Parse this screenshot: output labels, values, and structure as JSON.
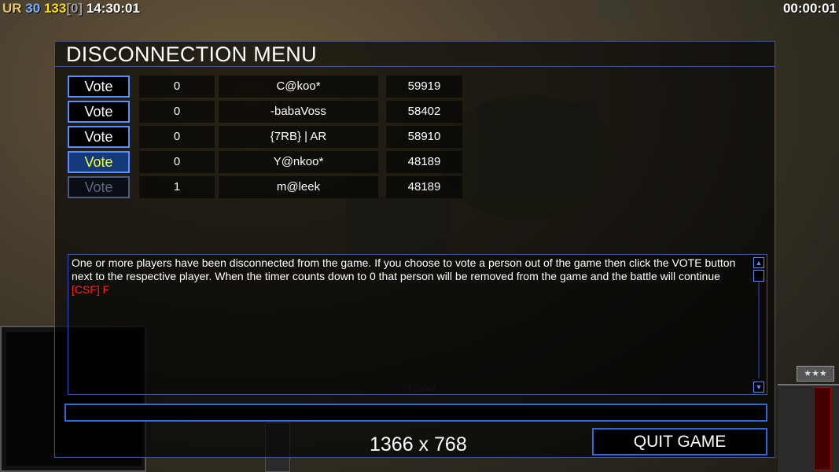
{
  "hud": {
    "prefix": "UR",
    "fps": "30",
    "latency": "133",
    "frame": "[0]",
    "clock": "14:30:01",
    "timer": "00:00:01"
  },
  "menu": {
    "title": "DISCONNECTION MENU",
    "players": [
      {
        "vote_label": "Vote",
        "votes": "0",
        "name": "C@koo*",
        "ping": "59919",
        "state": "normal"
      },
      {
        "vote_label": "Vote",
        "votes": "0",
        "name": "-babaVoss",
        "ping": "58402",
        "state": "normal"
      },
      {
        "vote_label": "Vote",
        "votes": "0",
        "name": "{7RB} | AR",
        "ping": "58910",
        "state": "normal"
      },
      {
        "vote_label": "Vote",
        "votes": "0",
        "name": "Y@nkoo*",
        "ping": "48189",
        "state": "hover"
      },
      {
        "vote_label": "Vote",
        "votes": "1",
        "name": "m@leek",
        "ping": "48189",
        "state": "disabled"
      }
    ],
    "message": "One or more players have been disconnected from the game. If you choose to vote a person out of the game then click the VOTE button next to the respective player. When the timer counts down to 0 that person will be removed from the game and the battle will continue",
    "chat_line": "[CSF] F",
    "chat_input_value": "",
    "resolution": "1366 x 768",
    "quit_label": "QUIT GAME"
  },
  "colors": {
    "border": "#2f52c8",
    "button_border": "#5a8dff",
    "hover_text": "#f0ff30",
    "chat_red": "#ff2020"
  },
  "icons": {
    "scroll_up": "up-arrow-icon",
    "scroll_down": "down-arrow-icon"
  }
}
